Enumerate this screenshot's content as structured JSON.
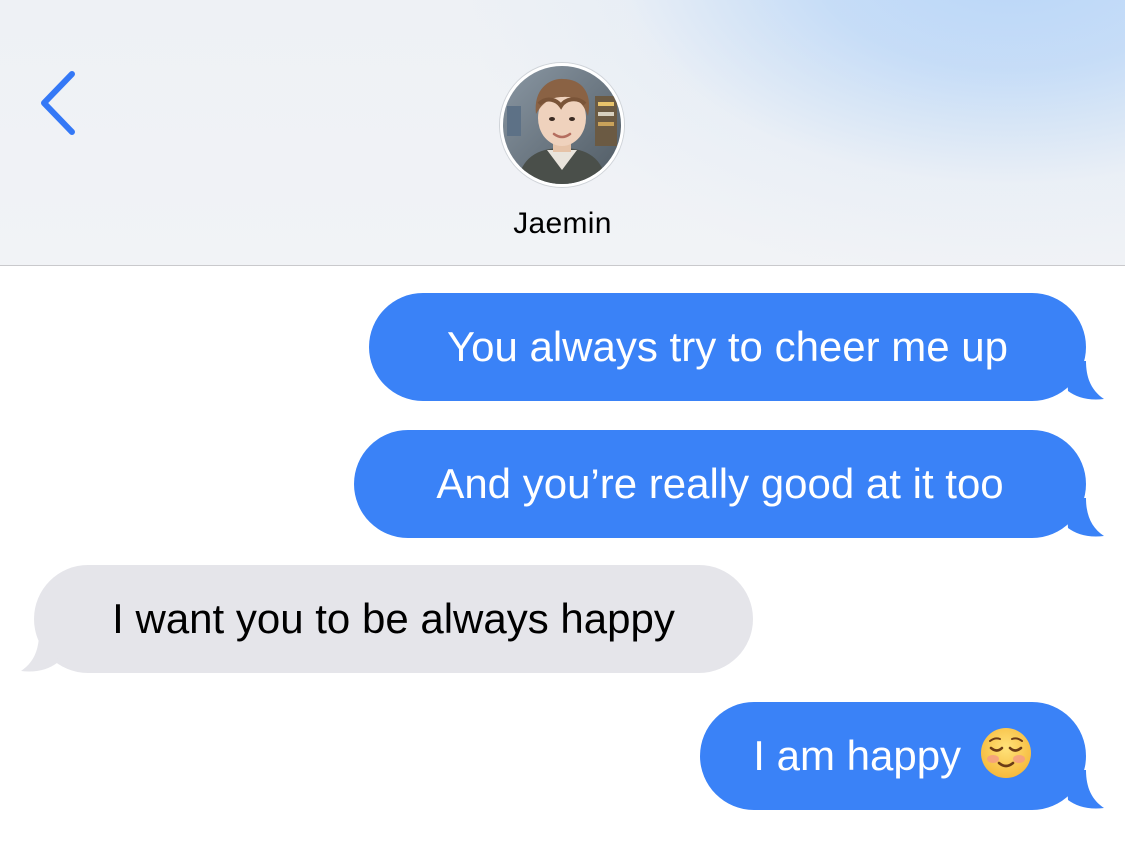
{
  "header": {
    "back_icon": "chevron-left-icon",
    "contact_name": "Jaemin",
    "avatar_icon": "contact-photo",
    "accent_color": "#3478f6"
  },
  "messages": [
    {
      "direction": "sent",
      "text": "You always try to cheer me up"
    },
    {
      "direction": "sent",
      "text": "And you’re really good at it too"
    },
    {
      "direction": "received",
      "text": "I want you to be always happy"
    },
    {
      "direction": "sent",
      "text": "I am happy",
      "emoji": "smiling-face-icon"
    }
  ],
  "colors": {
    "sent_bubble": "#3a82f7",
    "received_bubble": "#e5e5ea",
    "sent_text": "#ffffff",
    "received_text": "#000000"
  }
}
